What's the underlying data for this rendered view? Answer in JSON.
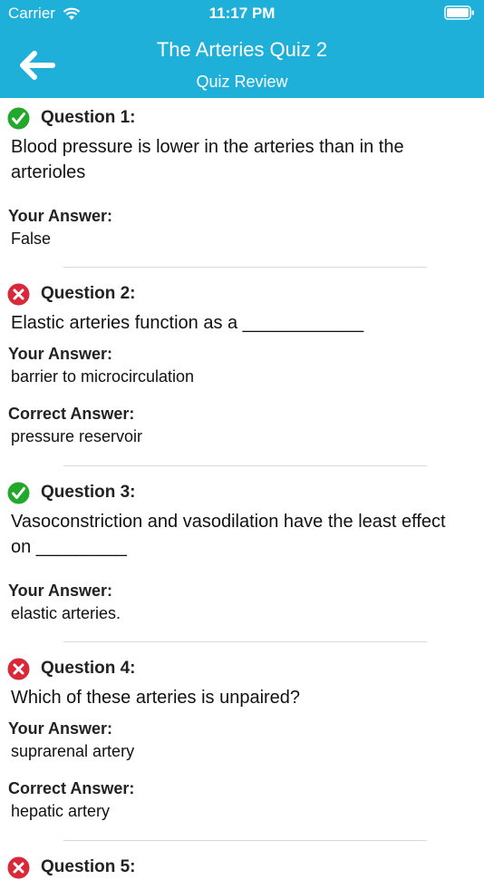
{
  "status_bar": {
    "carrier": "Carrier",
    "time": "11:17 PM"
  },
  "nav": {
    "title": "The Arteries Quiz 2",
    "subtitle": "Quiz Review"
  },
  "labels": {
    "your_answer": "Your Answer:",
    "correct_answer": "Correct Answer:"
  },
  "questions": [
    {
      "label": "Question 1:",
      "text": "Blood pressure is lower in the arteries than in the arterioles",
      "status": "correct",
      "your_answer": "False"
    },
    {
      "label": "Question 2:",
      "text": "Elastic arteries function as a ____________",
      "status": "incorrect",
      "your_answer": "barrier to microcirculation",
      "correct_answer": "pressure reservoir"
    },
    {
      "label": "Question 3:",
      "text": "Vasoconstriction and vasodilation have the least effect on _________",
      "status": "correct",
      "your_answer": "elastic arteries."
    },
    {
      "label": "Question 4:",
      "text": "Which of these arteries is unpaired?",
      "status": "incorrect",
      "your_answer": "suprarenal artery",
      "correct_answer": "hepatic artery"
    },
    {
      "label": "Question 5:",
      "status": "incorrect"
    }
  ],
  "colors": {
    "header": "#1fb0d9",
    "correct": "#22a82a",
    "incorrect": "#d9283a"
  }
}
